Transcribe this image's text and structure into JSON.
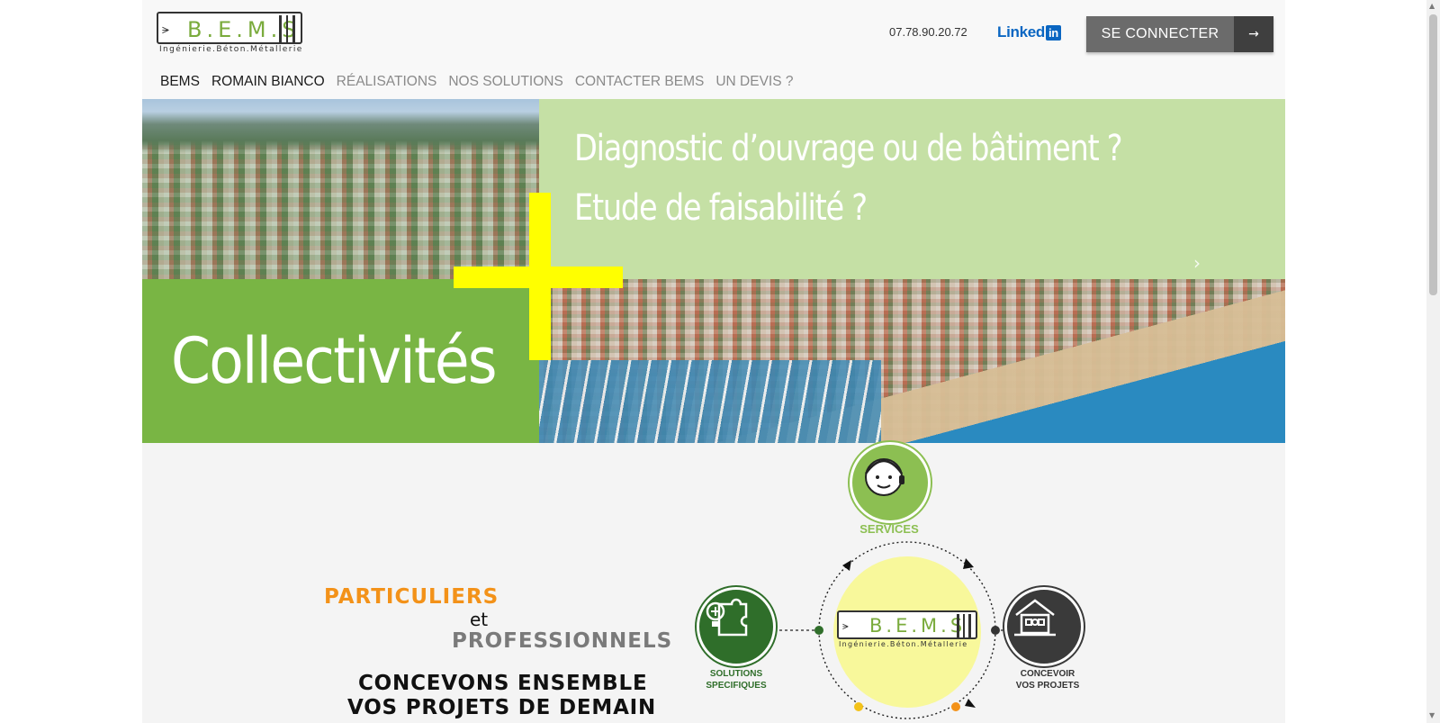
{
  "header": {
    "logo_text": "B.E.M.S",
    "logo_subtitle": "Ingénierie.Béton.Métallerie",
    "phone": "07.78.90.20.72",
    "linkedin_label": "Linked",
    "linkedin_badge": "in",
    "connect_label": "SE CONNECTER",
    "connect_arrow": "→"
  },
  "nav": {
    "items": [
      {
        "label": "BEMS"
      },
      {
        "label": "ROMAIN BIANCO"
      },
      {
        "label": "RÉALISATIONS"
      },
      {
        "label": "NOS SOLUTIONS"
      },
      {
        "label": "CONTACTER BEMS"
      },
      {
        "label": "UN DEVIS ?"
      }
    ]
  },
  "hero": {
    "line1": "Diagnostic d’ouvrage ou de bâtiment ?",
    "line2": "Etude de faisabilité ?",
    "big_word": "Collectivités",
    "next_icon": "›"
  },
  "content": {
    "tag_particuliers": "PARTICULIERS",
    "tag_et": "et",
    "tag_professionnels": "PROFESSIONNELS",
    "claim_line1": "CONCEVONS ENSEMBLE",
    "claim_line2": "VOS PROJETS DE DEMAIN"
  },
  "diagram": {
    "services_label": "SERVICES",
    "solutions_line1": "SOLUTIONS",
    "solutions_line2": "SPECIFIQUES",
    "projets_line1": "CONCEVOIR",
    "projets_line2": "VOS PROJETS",
    "center_logo_text": "B.E.M.S",
    "center_logo_subtitle": "Ingénierie.Béton.Métallerie"
  },
  "colors": {
    "accent_green": "#79b544",
    "light_green": "#c5e0a5",
    "orange": "#f39219",
    "yellow_cross": "#ffff00",
    "connect_bg": "#6b6b6b"
  }
}
